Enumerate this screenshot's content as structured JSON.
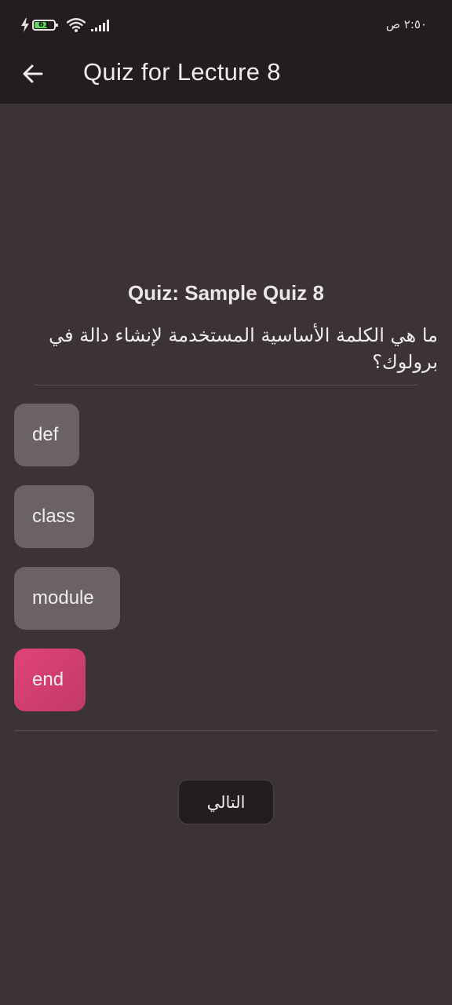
{
  "status_bar": {
    "battery_level": "61",
    "time": "٢:٥٠ ص",
    "icons": [
      "charging-icon",
      "battery-icon",
      "wifi-icon",
      "signal-icon"
    ]
  },
  "app_bar": {
    "title": "Quiz for Lecture 8",
    "back_icon": "arrow-left-icon"
  },
  "quiz": {
    "title": "Quiz: Sample Quiz 8",
    "question": "ما هي الكلمة الأساسية المستخدمة لإنشاء دالة في برولوك؟",
    "options": [
      {
        "label": "def",
        "selected": false
      },
      {
        "label": "class",
        "selected": false
      },
      {
        "label": "module",
        "selected": false
      },
      {
        "label": "end",
        "selected": true
      }
    ],
    "next_label": "التالي"
  },
  "colors": {
    "background": "#3c3335",
    "app_bar": "#231d1e",
    "option": "#6a6264",
    "selected_option": "#e0437b",
    "battery_fill": "#5fd35f"
  }
}
